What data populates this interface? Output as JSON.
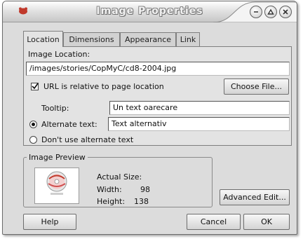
{
  "window": {
    "title": "Image Properties",
    "controls": [
      "minimize-icon",
      "maximize-icon",
      "close-icon"
    ]
  },
  "tabs": [
    {
      "label": "Location",
      "active": true
    },
    {
      "label": "Dimensions",
      "active": false
    },
    {
      "label": "Appearance",
      "active": false
    },
    {
      "label": "Link",
      "active": false
    }
  ],
  "location": {
    "section_label": "Image Location:",
    "path_value": "/images/stories/CopMyC/cd8-2004.jpg",
    "relative_checkbox_label": "URL is relative to page location",
    "relative_checked": true,
    "choose_file_label": "Choose File...",
    "tooltip_label": "Tooltip:",
    "tooltip_value": "Un text oarecare",
    "alt_radio_label": "Alternate text:",
    "alt_value": "Text alternativ",
    "alt_selected": true,
    "no_alt_radio_label": "Don't use alternate text"
  },
  "preview": {
    "legend": "Image Preview",
    "actual_size_label": "Actual Size:",
    "width_label": "Width:",
    "width_value": "98",
    "height_label": "Height:",
    "height_value": "138"
  },
  "buttons": {
    "advanced_edit": "Advanced Edit...",
    "help": "Help",
    "cancel": "Cancel",
    "ok": "OK"
  },
  "colors": {
    "window_bg": "#dcdcdc",
    "panel_bg": "#e3e3e3",
    "app_icon": "#c0392b"
  }
}
